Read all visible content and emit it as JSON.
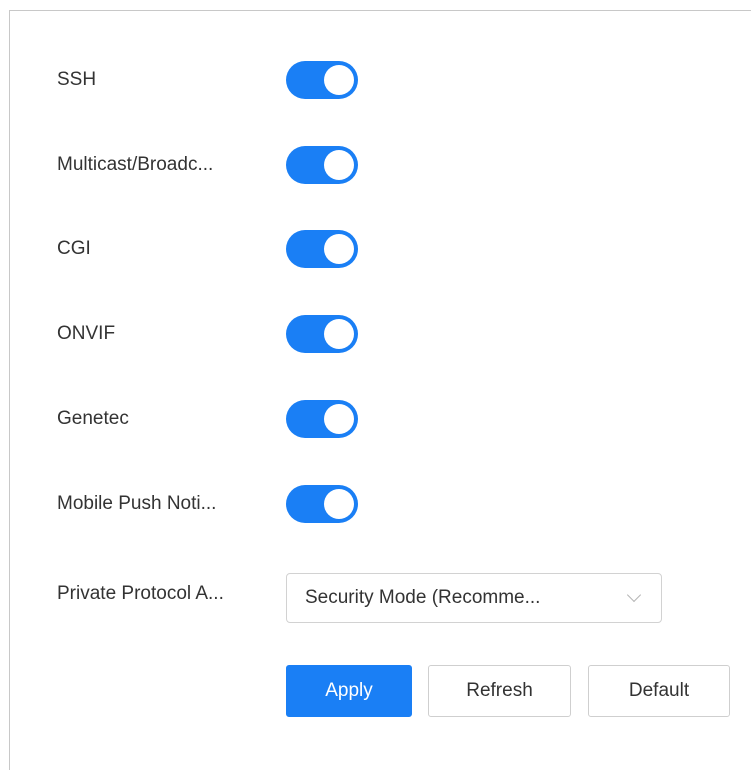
{
  "settings": {
    "items": [
      {
        "label": "SSH",
        "enabled": true
      },
      {
        "label": "Multicast/Broadc...",
        "enabled": true
      },
      {
        "label": "CGI",
        "enabled": true
      },
      {
        "label": "ONVIF",
        "enabled": true
      },
      {
        "label": "Genetec",
        "enabled": true
      },
      {
        "label": "Mobile Push Noti...",
        "enabled": true
      }
    ],
    "private_protocol": {
      "label": "Private Protocol A...",
      "value": "Security Mode (Recomme..."
    }
  },
  "actions": {
    "apply_label": "Apply",
    "refresh_label": "Refresh",
    "default_label": "Default"
  },
  "colors": {
    "accent": "#1a7ff5",
    "text": "#333333",
    "border": "#cfcfcf"
  }
}
